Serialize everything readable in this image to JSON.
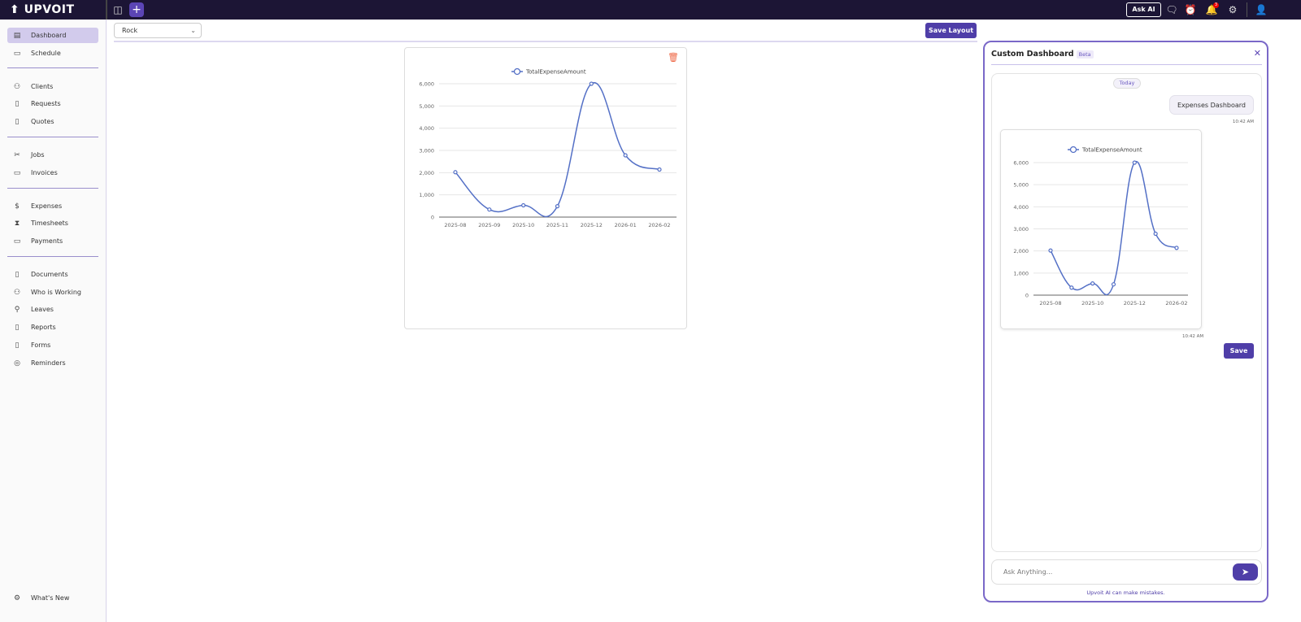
{
  "app": {
    "logo": "UPVOIT",
    "ask_ai": "Ask AI",
    "notification_count": "3"
  },
  "sidebar": {
    "items": [
      {
        "label": "Dashboard",
        "icon": "dashboard-icon",
        "active": true
      },
      {
        "label": "Schedule",
        "icon": "calendar-icon"
      },
      {
        "label": "Clients",
        "icon": "users-icon"
      },
      {
        "label": "Requests",
        "icon": "request-icon"
      },
      {
        "label": "Quotes",
        "icon": "quote-icon"
      },
      {
        "label": "Jobs",
        "icon": "tools-icon"
      },
      {
        "label": "Invoices",
        "icon": "invoice-icon"
      },
      {
        "label": "Expenses",
        "icon": "dollar-icon"
      },
      {
        "label": "Timesheets",
        "icon": "hourglass-icon"
      },
      {
        "label": "Payments",
        "icon": "card-icon"
      },
      {
        "label": "Documents",
        "icon": "document-icon"
      },
      {
        "label": "Who is Working",
        "icon": "team-icon"
      },
      {
        "label": "Leaves",
        "icon": "user-plus-icon"
      },
      {
        "label": "Reports",
        "icon": "report-icon"
      },
      {
        "label": "Forms",
        "icon": "form-icon"
      },
      {
        "label": "Reminders",
        "icon": "alarm-icon"
      }
    ],
    "whats_new": "What's New"
  },
  "toolbar": {
    "selected_dashboard": "Rock",
    "save_layout": "Save Layout"
  },
  "panel": {
    "title": "Custom Dashboard",
    "badge": "Beta",
    "today": "Today",
    "user_message": "Expenses Dashboard",
    "user_time": "10:42 AM",
    "bot_time": "10:42 AM",
    "save": "Save",
    "input_placeholder": "Ask Anything...",
    "disclaimer": "Upvoit AI can make mistakes."
  },
  "chart_data": {
    "type": "line",
    "legend": "TotalExpenseAmount",
    "categories": [
      "2025-08",
      "2025-09",
      "2025-10",
      "2025-11",
      "2025-12",
      "2026-01",
      "2026-02"
    ],
    "values": [
      2020,
      340,
      530,
      490,
      6000,
      2780,
      2140
    ],
    "yticks": [
      "0",
      "1,000",
      "2,000",
      "3,000",
      "4,000",
      "5,000",
      "6,000"
    ],
    "ylim": [
      0,
      6000
    ],
    "color": "#5470c6",
    "grid": true
  }
}
